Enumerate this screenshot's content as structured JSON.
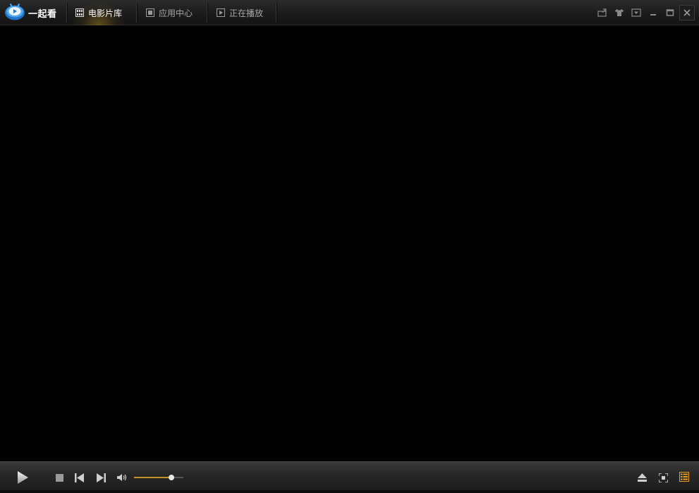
{
  "app": {
    "brand_name": "一起看",
    "brand_icon": "tv-logo-icon"
  },
  "tabs": [
    {
      "label": "电影片库",
      "icon": "film-grid-icon",
      "active": true
    },
    {
      "label": "应用中心",
      "icon": "app-box-icon",
      "active": false
    },
    {
      "label": "正在播放",
      "icon": "play-box-icon",
      "active": false
    }
  ],
  "window_controls": [
    "mini-mode-icon",
    "skin-shirt-icon",
    "menu-dropdown-icon",
    "minimize-icon",
    "maximize-icon",
    "close-icon"
  ],
  "player": {
    "volume": 0.75,
    "controls": [
      "play-icon",
      "stop-icon",
      "previous-icon",
      "next-icon",
      "volume-icon",
      "eject-icon",
      "fullscreen-icon",
      "playlist-icon"
    ]
  },
  "colors": {
    "accent": "#c8922a",
    "playlist_icon": "#e8a020",
    "background": "#000000"
  }
}
